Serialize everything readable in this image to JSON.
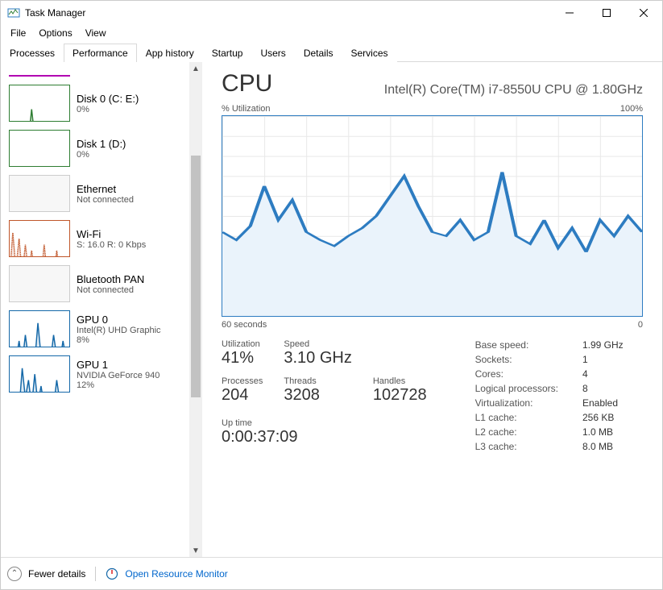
{
  "window": {
    "title": "Task Manager"
  },
  "menubar": [
    "File",
    "Options",
    "View"
  ],
  "tabs": [
    "Processes",
    "Performance",
    "App history",
    "Startup",
    "Users",
    "Details",
    "Services"
  ],
  "active_tab_index": 1,
  "sidebar": [
    {
      "name": "purple-top",
      "title": "",
      "sub": "",
      "border": "#b100b1",
      "thumb_only_border_bottom": true
    },
    {
      "name": "disk0",
      "title": "Disk 0 (C: E:)",
      "sub": "0%",
      "border": "#2e7d32",
      "series": [
        2,
        8,
        3,
        5,
        2,
        15,
        4,
        30,
        6,
        3,
        20,
        4,
        2,
        5,
        3,
        2,
        4,
        8,
        3,
        2
      ]
    },
    {
      "name": "disk1",
      "title": "Disk 1 (D:)",
      "sub": "0%",
      "border": "#2e7d32",
      "series": [
        0,
        0,
        0,
        0,
        0,
        0,
        0,
        0,
        0,
        0,
        0,
        0,
        0,
        0,
        0,
        0,
        0,
        0,
        2,
        0
      ]
    },
    {
      "name": "ethernet",
      "title": "Ethernet",
      "sub": "Not connected",
      "empty": true
    },
    {
      "name": "wifi",
      "title": "Wi-Fi",
      "sub": "S: 16.0  R: 0 Kbps",
      "border": "#c0562a",
      "series": [
        5,
        40,
        10,
        35,
        5,
        30,
        8,
        25,
        6,
        2,
        4,
        30,
        5,
        20,
        4,
        25,
        6,
        3,
        5,
        2
      ],
      "dotted": true
    },
    {
      "name": "bluetooth",
      "title": "Bluetooth PAN",
      "sub": "Not connected",
      "empty": true
    },
    {
      "name": "gpu0",
      "title": "GPU 0",
      "sub": "Intel(R) UHD Graphic",
      "sub2": "8%",
      "border": "#1468a8",
      "series": [
        10,
        12,
        8,
        25,
        6,
        30,
        10,
        15,
        8,
        40,
        12,
        10,
        20,
        8,
        30,
        12,
        8,
        25,
        10,
        8
      ]
    },
    {
      "name": "gpu1",
      "title": "GPU 1",
      "sub": "NVIDIA GeForce 940",
      "sub2": "12%",
      "border": "#1468a8",
      "series": [
        8,
        20,
        10,
        5,
        40,
        15,
        30,
        8,
        35,
        10,
        25,
        8,
        6,
        20,
        8,
        30,
        12,
        8,
        15,
        10
      ]
    }
  ],
  "cpu": {
    "heading": "CPU",
    "model": "Intel(R) Core(TM) i7-8550U CPU @ 1.80GHz",
    "chart_top_left": "% Utilization",
    "chart_top_right": "100%",
    "chart_bot_left": "60 seconds",
    "chart_bot_right": "0",
    "stats": {
      "utilization": {
        "label": "Utilization",
        "value": "41%"
      },
      "speed": {
        "label": "Speed",
        "value": "3.10 GHz"
      },
      "processes": {
        "label": "Processes",
        "value": "204"
      },
      "threads": {
        "label": "Threads",
        "value": "3208"
      },
      "handles": {
        "label": "Handles",
        "value": "102728"
      },
      "uptime": {
        "label": "Up time",
        "value": "0:00:37:09"
      }
    },
    "details": [
      {
        "label": "Base speed:",
        "value": "1.99 GHz"
      },
      {
        "label": "Sockets:",
        "value": "1"
      },
      {
        "label": "Cores:",
        "value": "4"
      },
      {
        "label": "Logical processors:",
        "value": "8"
      },
      {
        "label": "Virtualization:",
        "value": "Enabled"
      },
      {
        "label": "L1 cache:",
        "value": "256 KB"
      },
      {
        "label": "L2 cache:",
        "value": "1.0 MB"
      },
      {
        "label": "L3 cache:",
        "value": "8.0 MB"
      }
    ]
  },
  "chart_data": {
    "type": "line",
    "title": "CPU % Utilization",
    "xlabel": "seconds",
    "ylabel": "% Utilization",
    "xlim": [
      60,
      0
    ],
    "ylim": [
      0,
      100
    ],
    "x": [
      60,
      58,
      56,
      54,
      52,
      50,
      48,
      46,
      44,
      42,
      40,
      38,
      36,
      34,
      32,
      30,
      28,
      26,
      24,
      22,
      20,
      18,
      16,
      14,
      12,
      10,
      8,
      6,
      4,
      2,
      0
    ],
    "values": [
      42,
      38,
      45,
      65,
      48,
      58,
      42,
      38,
      35,
      40,
      44,
      50,
      60,
      70,
      55,
      42,
      40,
      48,
      38,
      42,
      72,
      40,
      36,
      48,
      34,
      44,
      32,
      48,
      40,
      50,
      42
    ]
  },
  "footer": {
    "fewer": "Fewer details",
    "resmon": "Open Resource Monitor"
  }
}
